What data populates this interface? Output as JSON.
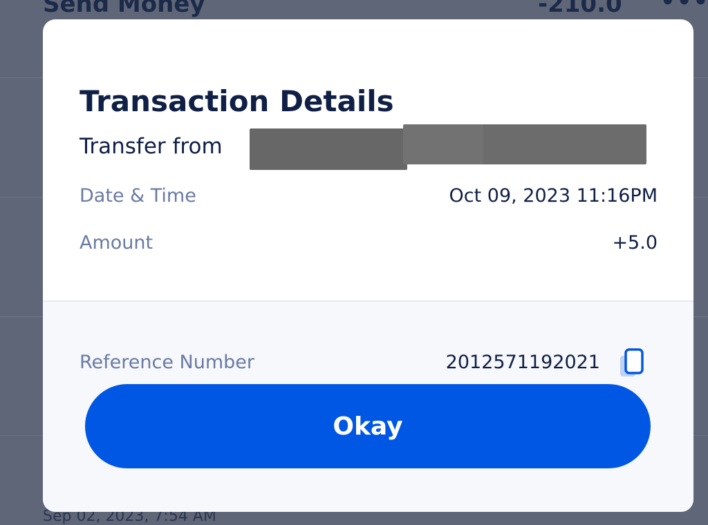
{
  "background": {
    "top_item": {
      "title": "Send Money",
      "amount": "-210.0",
      "more_icon": "more-dots-icon"
    },
    "bottom_item": {
      "date": "Sep 02, 2023, 7:54 AM"
    }
  },
  "modal": {
    "title": "Transaction Details",
    "transfer_label": "Transfer from",
    "date_label": "Date & Time",
    "date_value": "Oct 09, 2023 11:16PM",
    "amount_label": "Amount",
    "amount_value": "+5.0",
    "reference_label": "Reference Number",
    "reference_value": "2012571192021",
    "copy_icon": "copy-icon",
    "okay_label": "Okay"
  },
  "colors": {
    "primary": "#0057e4",
    "title_text": "#0f1f45",
    "label_text": "#6a7aa1",
    "overlay": "#5f6677"
  }
}
